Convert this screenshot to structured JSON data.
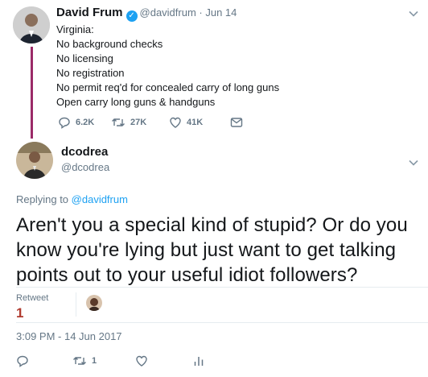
{
  "parent_tweet": {
    "author_name": "David Frum",
    "handle": "@davidfrum",
    "date": "Jun 14",
    "lines": [
      "Virginia:",
      "No background checks",
      "No licensing",
      "No registration",
      "No permit req'd for concealed carry of long guns",
      "Open carry long guns & handguns"
    ],
    "replies": "6.2K",
    "retweets": "27K",
    "likes": "41K"
  },
  "main_tweet": {
    "author_name": "dcodrea",
    "handle": "@dcodrea",
    "replying_prefix": "Replying to ",
    "replying_to": "@davidfrum",
    "text": "Aren't you a special kind of stupid? Or do you know you're lying but just want to get talking points out to your useful idiot followers?",
    "retweet_label": "Retweet",
    "retweet_count": "1",
    "timestamp": "3:09 PM - 14 Jun 2017",
    "action_retweets": "1"
  },
  "colors": {
    "thread_line": "#9b2b68",
    "link": "#1da1f2",
    "muted": "#657786"
  },
  "icons": [
    "reply-icon",
    "retweet-icon",
    "like-icon",
    "dm-icon",
    "analytics-icon",
    "chevron-down-icon",
    "verified-icon"
  ]
}
